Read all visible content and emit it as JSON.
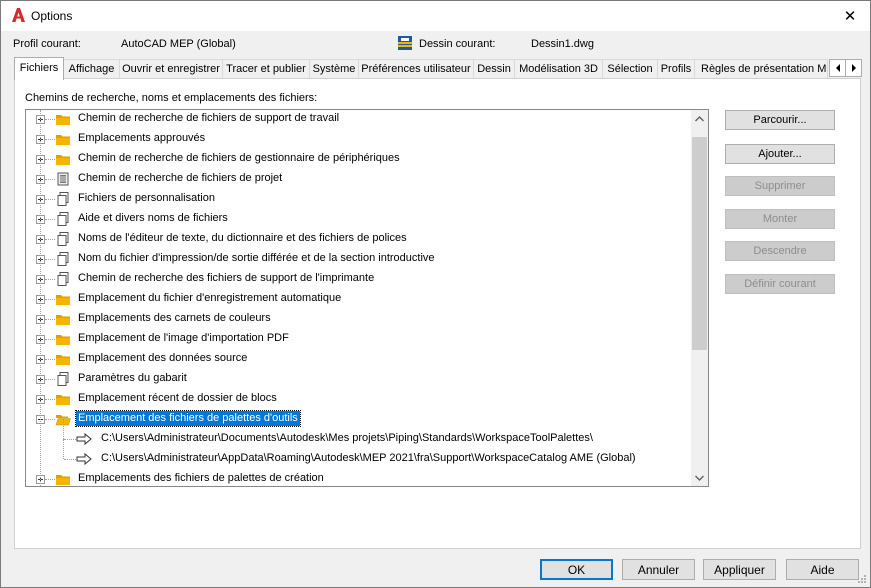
{
  "window": {
    "title": "Options",
    "close_glyph": "✕"
  },
  "profile": {
    "label": "Profil courant:",
    "value": "AutoCAD MEP (Global)"
  },
  "drawing": {
    "label": "Dessin courant:",
    "value": "Dessin1.dwg"
  },
  "tabs": [
    {
      "label": "Fichiers",
      "active": true
    },
    {
      "label": "Affichage"
    },
    {
      "label": "Ouvrir et enregistrer"
    },
    {
      "label": "Tracer et publier"
    },
    {
      "label": "Système"
    },
    {
      "label": "Préférences utilisateur"
    },
    {
      "label": "Dessin"
    },
    {
      "label": "Modélisation 3D"
    },
    {
      "label": "Sélection"
    },
    {
      "label": "Profils"
    },
    {
      "label": "Règles de présentation MEP"
    }
  ],
  "section_label": "Chemins de recherche, noms et emplacements des fichiers:",
  "tree": [
    {
      "label": "Chemin de recherche de fichiers de support de travail",
      "icon": "folder-icon"
    },
    {
      "label": "Emplacements approuvés",
      "icon": "folder-icon"
    },
    {
      "label": "Chemin de recherche de fichiers de gestionnaire de périphériques",
      "icon": "folder-icon"
    },
    {
      "label": "Chemin de recherche de fichiers de projet",
      "icon": "project-file-icon"
    },
    {
      "label": "Fichiers de personnalisation",
      "icon": "files-icon"
    },
    {
      "label": "Aide et divers noms de fichiers",
      "icon": "files-icon"
    },
    {
      "label": "Noms de l'éditeur de texte, du dictionnaire et des fichiers de polices",
      "icon": "files-icon"
    },
    {
      "label": "Nom du fichier d'impression/de sortie différée et de la section introductive",
      "icon": "files-icon"
    },
    {
      "label": "Chemin de recherche des fichiers de support de l'imprimante",
      "icon": "files-icon"
    },
    {
      "label": "Emplacement du fichier d'enregistrement automatique",
      "icon": "folder-icon"
    },
    {
      "label": "Emplacements des carnets de couleurs",
      "icon": "folder-icon"
    },
    {
      "label": "Emplacement de l'image d'importation PDF",
      "icon": "folder-icon"
    },
    {
      "label": "Emplacement des données source",
      "icon": "folder-icon"
    },
    {
      "label": "Paramètres du gabarit",
      "icon": "files-icon"
    },
    {
      "label": "Emplacement récent de dossier de blocs",
      "icon": "folder-icon"
    },
    {
      "label": "Emplacement des fichiers de palettes d'outils",
      "icon": "open-folder-icon",
      "expanded": true,
      "selected": true
    },
    {
      "label": "C:\\Users\\Administrateur\\Documents\\Autodesk\\Mes projets\\Piping\\Standards\\WorkspaceToolPalettes\\",
      "icon": "arrow-icon",
      "child": true
    },
    {
      "label": "C:\\Users\\Administrateur\\AppData\\Roaming\\Autodesk\\MEP 2021\\fra\\Support\\WorkspaceCatalog AME (Global)",
      "icon": "arrow-icon",
      "child": true
    },
    {
      "label": "Emplacements des fichiers de palettes de création",
      "icon": "folder-icon"
    }
  ],
  "side_buttons": [
    {
      "label": "Parcourir...",
      "enabled": true
    },
    {
      "label": "Ajouter...",
      "enabled": true
    },
    {
      "label": "Supprimer",
      "enabled": false
    },
    {
      "label": "Monter",
      "enabled": false
    },
    {
      "label": "Descendre",
      "enabled": false
    },
    {
      "label": "Définir courant",
      "enabled": false
    }
  ],
  "footer": {
    "ok": "OK",
    "cancel": "Annuler",
    "apply": "Appliquer",
    "help": "Aide"
  },
  "colors": {
    "selection": "#0078d7",
    "folder": "#f5b400",
    "accent_red": "#d62b2b"
  }
}
